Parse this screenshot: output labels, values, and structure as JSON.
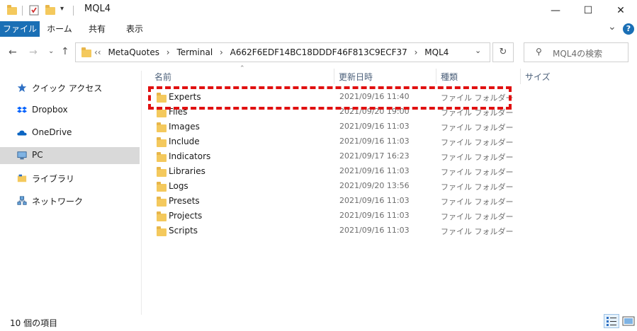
{
  "window": {
    "title": "MQL4",
    "minimize": "—",
    "maximize": "☐",
    "close": "✕"
  },
  "ribbon": {
    "tabs": [
      "ファイル",
      "ホーム",
      "共有",
      "表示"
    ],
    "collapse": "⌄",
    "help": "?"
  },
  "address": {
    "overflow": "‹‹",
    "crumbs": [
      "MetaQuotes",
      "Terminal",
      "A662F6EDF14BC18DDDF46F813C9ECF37",
      "MQL4"
    ],
    "separator": "›"
  },
  "search": {
    "placeholder": "MQL4の検索"
  },
  "sidebar": {
    "items": [
      {
        "label": "クイック アクセス",
        "icon": "star-icon"
      },
      {
        "label": "Dropbox",
        "icon": "dropbox-icon"
      },
      {
        "label": "OneDrive",
        "icon": "cloud-icon"
      },
      {
        "label": "PC",
        "icon": "pc-icon",
        "selected": true
      },
      {
        "label": "ライブラリ",
        "icon": "library-icon"
      },
      {
        "label": "ネットワーク",
        "icon": "network-icon"
      }
    ]
  },
  "columns": {
    "name": "名前",
    "date": "更新日時",
    "type": "種類",
    "size": "サイズ"
  },
  "files": [
    {
      "name": "Experts",
      "date": "2021/09/16 11:40",
      "type": "ファイル フォルダー"
    },
    {
      "name": "Files",
      "date": "2021/09/20 19:00",
      "type": "ファイル フォルダー"
    },
    {
      "name": "Images",
      "date": "2021/09/16 11:03",
      "type": "ファイル フォルダー"
    },
    {
      "name": "Include",
      "date": "2021/09/16 11:03",
      "type": "ファイル フォルダー"
    },
    {
      "name": "Indicators",
      "date": "2021/09/17 16:23",
      "type": "ファイル フォルダー"
    },
    {
      "name": "Libraries",
      "date": "2021/09/16 11:03",
      "type": "ファイル フォルダー"
    },
    {
      "name": "Logs",
      "date": "2021/09/20 13:56",
      "type": "ファイル フォルダー"
    },
    {
      "name": "Presets",
      "date": "2021/09/16 11:03",
      "type": "ファイル フォルダー"
    },
    {
      "name": "Projects",
      "date": "2021/09/16 11:03",
      "type": "ファイル フォルダー"
    },
    {
      "name": "Scripts",
      "date": "2021/09/16 11:03",
      "type": "ファイル フォルダー"
    }
  ],
  "status": {
    "item_count": "10 個の項目"
  },
  "colors": {
    "accent": "#1a6fb5",
    "highlight": "#e01010",
    "folder": "#f4c95d"
  }
}
